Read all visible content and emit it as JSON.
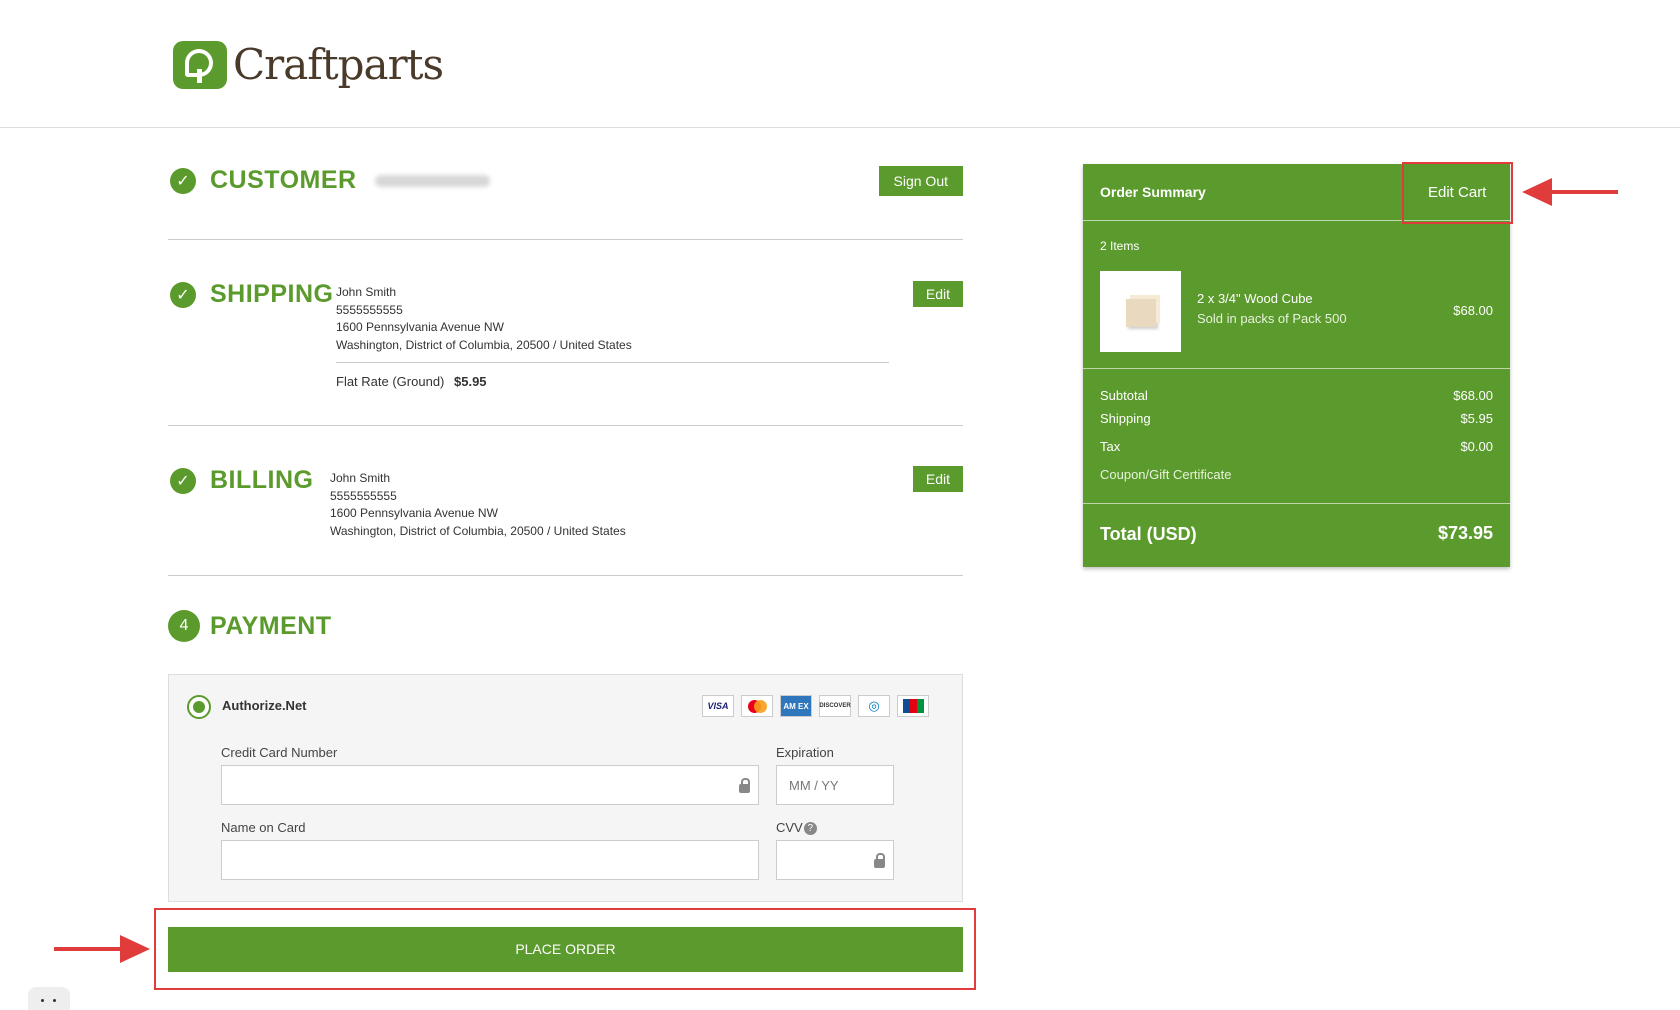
{
  "brand": {
    "name": "Craftparts",
    "accent_color": "#5b9a2c",
    "highlight_color": "#e03c3c"
  },
  "customer": {
    "title": "CUSTOMER",
    "sign_out_label": "Sign Out"
  },
  "shipping": {
    "title": "SHIPPING",
    "edit_label": "Edit",
    "address": [
      "John Smith",
      "5555555555",
      "1600 Pennsylvania Avenue NW",
      "Washington, District of Columbia, 20500 / United States"
    ],
    "method_name": "Flat Rate (Ground)",
    "method_price": "$5.95"
  },
  "billing": {
    "title": "BILLING",
    "edit_label": "Edit",
    "address": [
      "John Smith",
      "5555555555",
      "1600 Pennsylvania Avenue NW",
      "Washington, District of Columbia, 20500 / United States"
    ]
  },
  "payment": {
    "step_number": "4",
    "title": "PAYMENT",
    "method_name": "Authorize.Net",
    "card_icons": [
      "visa-icon",
      "mastercard-icon",
      "amex-icon",
      "discover-icon",
      "diners-club-icon",
      "jcb-icon"
    ],
    "card_labels": {
      "visa": "VISA",
      "amex": "AM EX",
      "discover": "DISCOVER"
    },
    "fields": {
      "card_number_label": "Credit Card Number",
      "expiration_label": "Expiration",
      "expiration_placeholder": "MM / YY",
      "name_label": "Name on Card",
      "cvv_label": "CVV"
    },
    "place_order_label": "PLACE ORDER"
  },
  "order_summary": {
    "title": "Order Summary",
    "edit_cart_label": "Edit Cart",
    "items_count": "2 Items",
    "item": {
      "name": "2 x 3/4\" Wood Cube",
      "subtitle": "Sold in packs of Pack 500",
      "price": "$68.00"
    },
    "subtotal_label": "Subtotal",
    "subtotal_value": "$68.00",
    "shipping_label": "Shipping",
    "shipping_value": "$5.95",
    "tax_label": "Tax",
    "tax_value": "$0.00",
    "coupon_label": "Coupon/Gift Certificate",
    "total_label": "Total (USD)",
    "total_value": "$73.95"
  }
}
